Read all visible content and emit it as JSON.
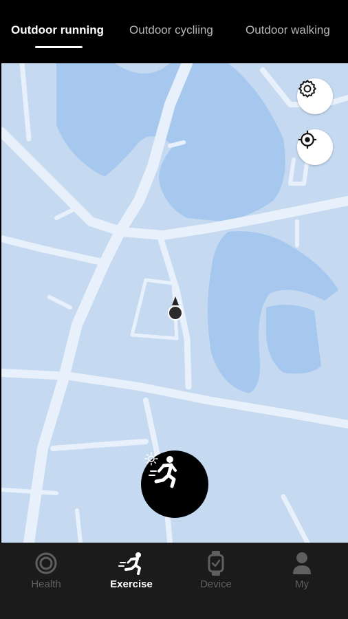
{
  "tabs": [
    {
      "label": "Outdoor running",
      "active": true
    },
    {
      "label": "Outdoor cycliing",
      "active": false
    },
    {
      "label": "Outdoor walking",
      "active": false
    }
  ],
  "map": {
    "buttons": {
      "settings_icon": "gear-icon",
      "locate_icon": "crosshair-icon"
    },
    "marker_icon": "location-marker-icon",
    "start_button_icon": "running-person-icon"
  },
  "bottom_nav": [
    {
      "label": "Health",
      "icon": "ring-icon",
      "active": false
    },
    {
      "label": "Exercise",
      "icon": "running-icon",
      "active": true
    },
    {
      "label": "Device",
      "icon": "watch-icon",
      "active": false
    },
    {
      "label": "My",
      "icon": "person-icon",
      "active": false
    }
  ],
  "colors": {
    "map_land": "#c5d9f1",
    "map_water": "#a6c8ef",
    "map_road": "#e8f1fb",
    "nav_background": "#1b1b1b",
    "active": "#ffffff",
    "inactive": "#5f5f5f"
  }
}
